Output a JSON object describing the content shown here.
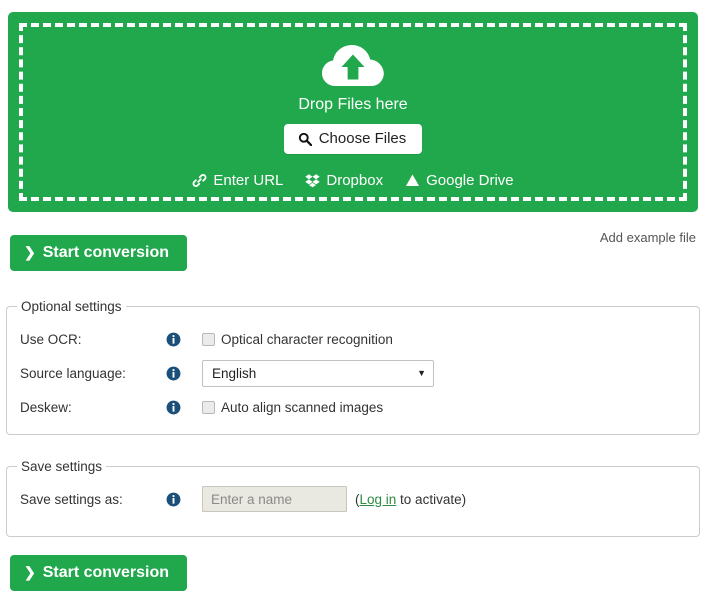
{
  "theme": {
    "brand_green": "#22a84c",
    "link_green": "#2e8b40",
    "info_blue": "#1a4f7a",
    "text": "#333333"
  },
  "dropzone": {
    "upload_icon": "cloud-upload-icon",
    "drop_label": "Drop Files here",
    "choose_files": {
      "label": "Choose Files",
      "icon": "search-icon"
    },
    "sources": [
      {
        "label": "Enter URL",
        "icon": "link-icon"
      },
      {
        "label": "Dropbox",
        "icon": "dropbox-icon"
      },
      {
        "label": "Google Drive",
        "icon": "google-drive-icon"
      }
    ]
  },
  "actions": {
    "start_conversion_top": "Start conversion",
    "start_conversion_bottom": "Start conversion",
    "chevron": "❯",
    "add_example_file": "Add example file"
  },
  "optional_settings": {
    "legend": "Optional settings",
    "rows": [
      {
        "label": "Use OCR:",
        "info_icon": "info-icon",
        "control": "checkbox",
        "checkbox_label": "Optical character recognition",
        "checked": false
      },
      {
        "label": "Source language:",
        "info_icon": "info-icon",
        "control": "select",
        "value": "English",
        "caret": "▼"
      },
      {
        "label": "Deskew:",
        "info_icon": "info-icon",
        "control": "checkbox",
        "checkbox_label": "Auto align scanned images",
        "checked": false
      }
    ]
  },
  "save_settings": {
    "legend": "Save settings",
    "row": {
      "label": "Save settings as:",
      "info_icon": "info-icon",
      "input_value": "",
      "input_placeholder": "Enter a name",
      "note_prefix": "(",
      "note_link": "Log in",
      "note_suffix": " to activate)"
    }
  }
}
